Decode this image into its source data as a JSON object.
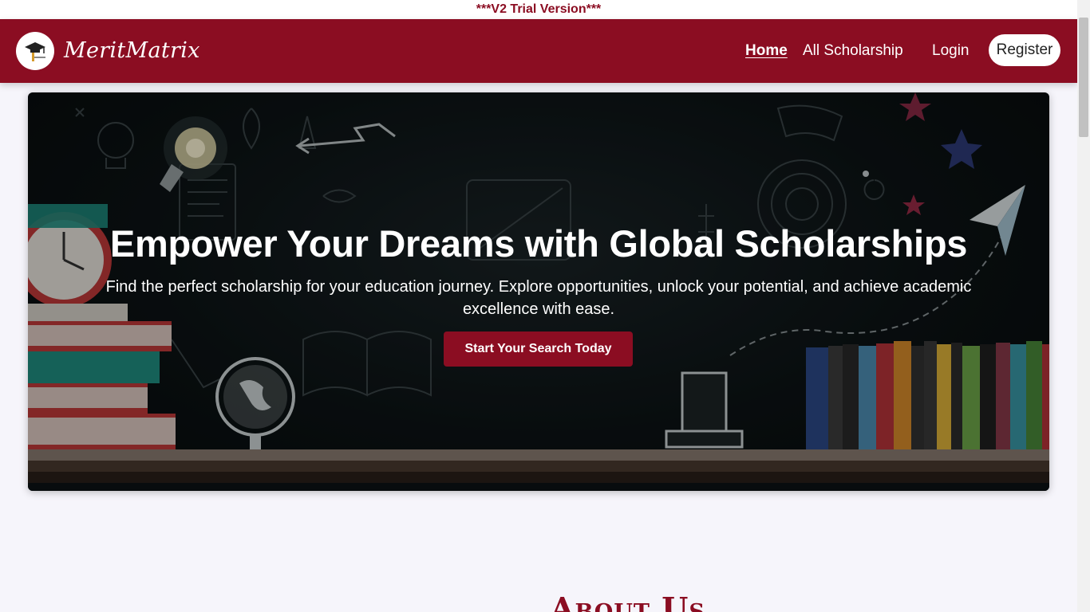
{
  "trial_banner": "***V2 Trial Version***",
  "brand": {
    "name": "MeritMatrix",
    "logo_icon": "graduate-cap-icon"
  },
  "nav": {
    "home": "Home",
    "all_scholarship": "All Scholarship",
    "login": "Login",
    "register": "Register"
  },
  "hero": {
    "title": "Empower Your Dreams with Global Scholarships",
    "subtitle": "Find the perfect scholarship for your education journey. Explore opportunities, unlock your potential, and achieve academic excellence with ease.",
    "cta": "Start Your Search Today"
  },
  "about": {
    "heading": "About Us"
  },
  "colors": {
    "brand": "#8b0d22",
    "background": "#f6f5fb",
    "hero_bg": "#0c1315"
  }
}
